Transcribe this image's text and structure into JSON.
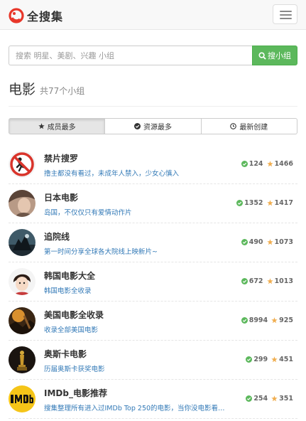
{
  "header": {
    "brand": "全搜集",
    "menu_icon": "hamburger-menu-icon"
  },
  "search": {
    "placeholder": "搜索 明星、美剧、兴趣 小组",
    "value": "",
    "button_label": "搜小组"
  },
  "category": {
    "title": "电影",
    "count_text": "共77个小组"
  },
  "tabs": [
    {
      "label": "成员最多",
      "icon": "star-icon",
      "active": true
    },
    {
      "label": "资源最多",
      "icon": "check-circle-icon",
      "active": false
    },
    {
      "label": "最新创建",
      "icon": "clock-icon",
      "active": false
    }
  ],
  "colors": {
    "accent_green": "#5cb85c",
    "star_orange": "#f0ad4e",
    "link_blue": "#337ab7"
  },
  "groups": [
    {
      "title": "禁片搜罗",
      "desc": "撸主都没有看过，未成年人禁入，少女心慎入",
      "resources": "124",
      "members": "1466",
      "avatar": "no-entry-sign-avatar"
    },
    {
      "title": "日本电影",
      "desc": "岛国，不仅仅只有爱情动作片",
      "resources": "1352",
      "members": "1417",
      "avatar": "portrait-avatar"
    },
    {
      "title": "追院线",
      "desc": "第一时间分享全球各大院线上映新片~",
      "resources": "490",
      "members": "1073",
      "avatar": "movie-poster-avatar"
    },
    {
      "title": "韩国电影大全",
      "desc": "韩国电影全收录",
      "resources": "672",
      "members": "1013",
      "avatar": "cartoon-boy-avatar"
    },
    {
      "title": "美国电影全收录",
      "desc": "收录全部美国电影",
      "resources": "8994",
      "members": "925",
      "avatar": "film-still-avatar"
    },
    {
      "title": "奥斯卡电影",
      "desc": "历届奥斯卡获奖电影",
      "resources": "299",
      "members": "451",
      "avatar": "oscar-statue-avatar"
    },
    {
      "title": "IMDb_电影推荐",
      "desc": "搜集整理所有进入过IMDb Top 250的电影，当你没电影看…",
      "resources": "254",
      "members": "351",
      "avatar": "imdb-logo-avatar"
    }
  ]
}
